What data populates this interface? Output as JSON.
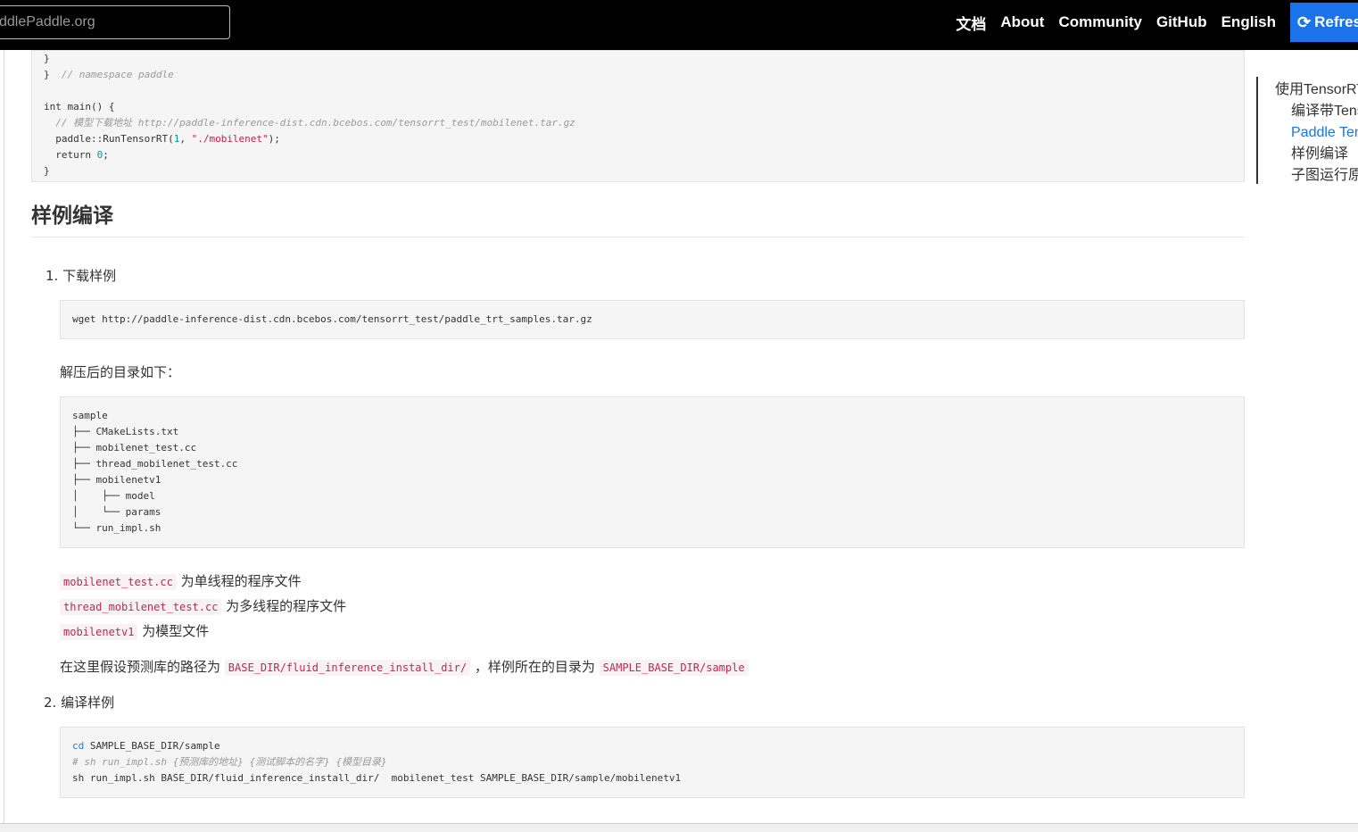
{
  "topbar": {
    "search_value": "ddlePaddle.org",
    "nav": [
      "文档",
      "About",
      "Community",
      "GitHub",
      "English"
    ],
    "refresh_label": "Refresh",
    "refresh_icon": "refresh-icon"
  },
  "code_top": {
    "lines": [
      "}",
      "}  // namespace paddle",
      "",
      "int main() {",
      "  // 模型下载地址 http://paddle-inference-dist.cdn.bcebos.com/tensorrt_test/mobilenet.tar.gz",
      "  paddle::RunTensorRT(1, \"./mobilenet\");",
      "  return 0;",
      "}"
    ]
  },
  "section": {
    "title": "样例编译"
  },
  "step1": {
    "label": "1. 下载样例",
    "wget": "wget http://paddle-inference-dist.cdn.bcebos.com/tensorrt_test/paddle_trt_samples.tar.gz",
    "after_extract": "解压后的目录如下：",
    "tree": [
      "sample",
      "├── CMakeLists.txt",
      "├── mobilenet_test.cc",
      "├── thread_mobilenet_test.cc",
      "├── mobilenetv1",
      "│    ├── model",
      "│    └── params",
      "└── run_impl.sh"
    ],
    "files": [
      {
        "code": "mobilenet_test.cc",
        "desc": " 为单线程的程序文件"
      },
      {
        "code": "thread_mobilenet_test.cc",
        "desc": " 为多线程的程序文件"
      },
      {
        "code": "mobilenetv1",
        "desc": " 为模型文件"
      }
    ],
    "assume_prefix": "在这里假设预测库的路径为 ",
    "assume_code1": "BASE_DIR/fluid_inference_install_dir/",
    "assume_mid": " ，样例所在的目录为 ",
    "assume_code2": "SAMPLE_BASE_DIR/sample"
  },
  "step2": {
    "label": "2. 编译样例",
    "cmd1_kw": "cd",
    "cmd1_rest": " SAMPLE_BASE_DIR/sample",
    "cmd2": "# sh run_impl.sh {预测库的地址} {测试脚本的名字} {模型目录}",
    "cmd3": "sh run_impl.sh BASE_DIR/fluid_inference_install_dir/  mobilenet_test SAMPLE_BASE_DIR/sample/mobilenetv1"
  },
  "toc": {
    "items": [
      {
        "label": "使用TensorRT库预测",
        "active": false
      },
      {
        "label": "编译带TensorRT的预测库",
        "active": false
      },
      {
        "label": "Paddle TensorRT使用",
        "active": true
      },
      {
        "label": "样例编译",
        "active": false
      },
      {
        "label": "子图运行原理",
        "active": false
      }
    ]
  },
  "colors": {
    "topbar": "#000000",
    "accent": "#1a73e8",
    "inline_code": "#c7254e",
    "code_bg": "#f5f5f5"
  }
}
